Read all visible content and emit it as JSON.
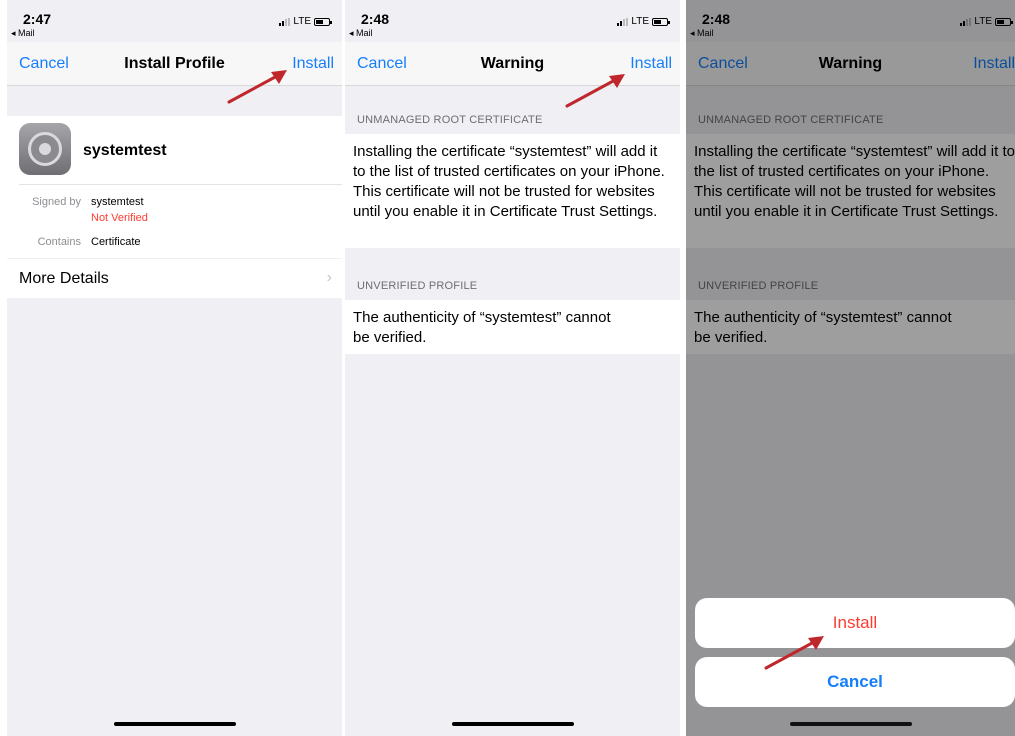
{
  "panels": [
    {
      "status": {
        "time": "2:47",
        "back": "◂ Mail",
        "network": "LTE"
      },
      "nav": {
        "left": "Cancel",
        "title": "Install Profile",
        "right": "Install"
      },
      "profile": {
        "name": "systemtest",
        "signed_by_key": "Signed by",
        "signed_by_value": "systemtest",
        "verification": "Not Verified",
        "contains_key": "Contains",
        "contains_value": "Certificate"
      },
      "more_details": "More Details"
    },
    {
      "status": {
        "time": "2:48",
        "back": "◂ Mail",
        "network": "LTE"
      },
      "nav": {
        "left": "Cancel",
        "title": "Warning",
        "right": "Install"
      },
      "sections": [
        {
          "header": "UNMANAGED ROOT CERTIFICATE",
          "text": "Installing the certificate “systemtest” will add it to the list of trusted certificates on your iPhone. This certificate will not be trusted for websites until you enable it in Certificate Trust Settings."
        },
        {
          "header": "UNVERIFIED PROFILE",
          "text": "The authenticity of “systemtest” cannot be verified."
        }
      ]
    },
    {
      "status": {
        "time": "2:48",
        "back": "◂ Mail",
        "network": "LTE"
      },
      "nav": {
        "left": "Cancel",
        "title": "Warning",
        "right": "Install"
      },
      "sections": [
        {
          "header": "UNMANAGED ROOT CERTIFICATE",
          "text": "Installing the certificate “systemtest” will add it to the list of trusted certificates on your iPhone. This certificate will not be trusted for websites until you enable it in Certificate Trust Settings."
        },
        {
          "header": "UNVERIFIED PROFILE",
          "text": "The authenticity of “systemtest” cannot be verified."
        }
      ],
      "action_sheet": {
        "install": "Install",
        "cancel": "Cancel"
      }
    }
  ],
  "colors": {
    "link": "#157efb",
    "destructive": "#ff3b30",
    "arrow": "#c0272d",
    "background": "#efeff4"
  },
  "icons": [
    "signal-icon",
    "battery-icon",
    "chevron-right-icon",
    "settings-gear-icon",
    "pointer-arrow-icon"
  ]
}
